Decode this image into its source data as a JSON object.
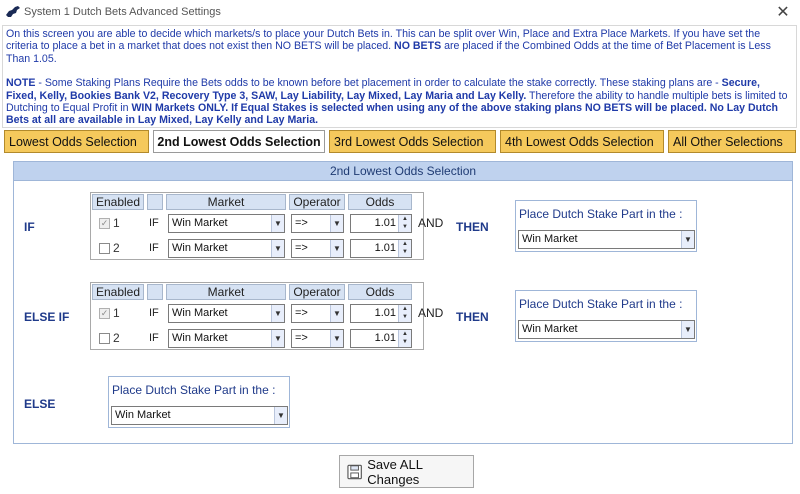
{
  "window": {
    "title": "System 1 Dutch Bets Advanced Settings",
    "close_glyph": "✕"
  },
  "info": {
    "para1_a": "On this screen you are able to decide which markets/s to place your Dutch Bets in. This can be split over Win, Place and Extra Place Markets. If you have set the criteria to place a bet in a market that does not exist then NO BETS will be placed. ",
    "para1_b": "NO BETS",
    "para1_c": " are placed if the Combined Odds at the time of Bet Placement is Less Than  1.05.",
    "note_a": "NOTE",
    "note_b": " - Some Staking Plans Require the Bets odds to be known before bet placement in order to calculate the stake correctly. These  staking plans are - ",
    "note_plans": "Secure, Fixed, Kelly, Bookies Bank V2, Recovery Type 3, SAW, Lay Liability, Lay Mixed, Lay Maria and Lay Kelly.",
    "note_c": " Therefore the ability to handle multiple bets is limited to Dutching to Equal Profit in ",
    "note_d": "WIN Markets ONLY. If Equal Stakes is selected when using any of the above staking plans NO BETS will be placed. No Lay Dutch Bets at all are available in Lay Mixed, Lay Kelly and Lay Maria."
  },
  "tabs": [
    {
      "label": "Lowest Odds Selection"
    },
    {
      "label": "2nd Lowest Odds Selection"
    },
    {
      "label": "3rd Lowest Odds Selection"
    },
    {
      "label": "4th Lowest Odds Selection"
    },
    {
      "label": "All Other Selections"
    }
  ],
  "panel": {
    "title": "2nd Lowest Odds Selection",
    "headers": {
      "enabled": "Enabled",
      "market": "Market",
      "operator": "Operator",
      "odds": "Odds"
    },
    "if_word": "IF",
    "and_word": "AND",
    "then_word": "THEN",
    "place_label": "Place Dutch Stake Part in the :",
    "blocks": [
      {
        "label": "IF",
        "rows": [
          {
            "num": "1",
            "checked": true,
            "disabled": true,
            "market": "Win Market",
            "operator": "=>",
            "odds": "1.01"
          },
          {
            "num": "2",
            "checked": false,
            "disabled": false,
            "market": "Win Market",
            "operator": "=>",
            "odds": "1.01"
          }
        ],
        "place_value": "Win Market"
      },
      {
        "label": "ELSE IF",
        "rows": [
          {
            "num": "1",
            "checked": true,
            "disabled": true,
            "market": "Win Market",
            "operator": "=>",
            "odds": "1.01"
          },
          {
            "num": "2",
            "checked": false,
            "disabled": false,
            "market": "Win Market",
            "operator": "=>",
            "odds": "1.01"
          }
        ],
        "place_value": "Win Market"
      }
    ],
    "else": {
      "label": "ELSE",
      "place_value": "Win Market"
    }
  },
  "save_button": {
    "label": "Save ALL Changes"
  },
  "colors": {
    "accent_tab": "#f5c95c",
    "text_blue": "#1f3aa8",
    "panel_header": "#bfd2ee"
  }
}
